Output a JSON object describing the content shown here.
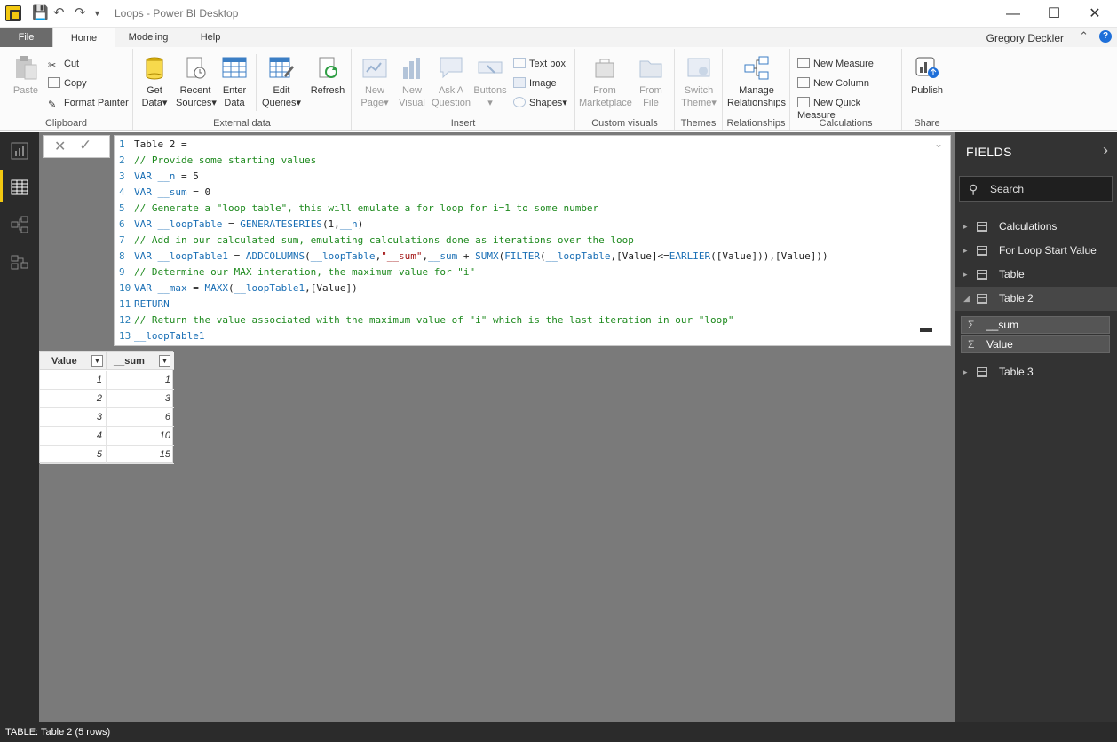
{
  "window": {
    "title": "Loops - Power BI Desktop",
    "user": "Gregory Deckler",
    "help_label": "?"
  },
  "tabs": [
    "File",
    "Home",
    "Modeling",
    "Help"
  ],
  "ribbon": {
    "clipboard": {
      "paste": "Paste",
      "cut": "Cut",
      "copy": "Copy",
      "format_painter": "Format Painter",
      "label": "Clipboard"
    },
    "external_data": {
      "get_data_1": "Get",
      "get_data_2": "Data",
      "recent_1": "Recent",
      "recent_2": "Sources",
      "enter_1": "Enter",
      "enter_2": "Data",
      "edit_1": "Edit",
      "edit_2": "Queries",
      "refresh": "Refresh",
      "label": "External data"
    },
    "insert": {
      "new_page_1": "New",
      "new_page_2": "Page",
      "new_visual_1": "New",
      "new_visual_2": "Visual",
      "ask_1": "Ask A",
      "ask_2": "Question",
      "buttons": "Buttons",
      "text_box": "Text box",
      "image": "Image",
      "shapes": "Shapes",
      "label": "Insert"
    },
    "custom_visuals": {
      "from_market_1": "From",
      "from_market_2": "Marketplace",
      "from_file_1": "From",
      "from_file_2": "File",
      "label": "Custom visuals"
    },
    "themes": {
      "switch_1": "Switch",
      "switch_2": "Theme",
      "label": "Themes"
    },
    "relationships": {
      "manage_1": "Manage",
      "manage_2": "Relationships",
      "label": "Relationships"
    },
    "calculations": {
      "new_measure": "New Measure",
      "new_column": "New Column",
      "new_quick_measure": "New Quick Measure",
      "label": "Calculations"
    },
    "share": {
      "publish": "Publish",
      "label": "Share"
    }
  },
  "editor": {
    "lines": [
      {
        "n": "1",
        "segs": [
          {
            "t": "Table 2 =",
            "c": ""
          }
        ]
      },
      {
        "n": "2",
        "segs": [
          {
            "t": "// Provide some starting values",
            "c": "cm"
          }
        ]
      },
      {
        "n": "3",
        "segs": [
          {
            "t": "VAR __n",
            "c": "kw"
          },
          {
            "t": " = 5",
            "c": ""
          }
        ]
      },
      {
        "n": "4",
        "segs": [
          {
            "t": "VAR __sum",
            "c": "kw"
          },
          {
            "t": " = 0",
            "c": ""
          }
        ]
      },
      {
        "n": "5",
        "segs": [
          {
            "t": "// Generate a \"loop table\", this will emulate a for loop for i=1 to some number",
            "c": "cm"
          }
        ]
      },
      {
        "n": "6",
        "segs": [
          {
            "t": "VAR __loopTable",
            "c": "kw"
          },
          {
            "t": " = ",
            "c": ""
          },
          {
            "t": "GENERATESERIES",
            "c": "kw"
          },
          {
            "t": "(1,",
            "c": ""
          },
          {
            "t": "__n",
            "c": "kw"
          },
          {
            "t": ")",
            "c": ""
          }
        ]
      },
      {
        "n": "7",
        "segs": [
          {
            "t": "// Add in our calculated sum, emulating calculations done as iterations over the loop",
            "c": "cm"
          }
        ]
      },
      {
        "n": "8",
        "segs": [
          {
            "t": "VAR __loopTable1",
            "c": "kw"
          },
          {
            "t": " = ",
            "c": ""
          },
          {
            "t": "ADDCOLUMNS",
            "c": "kw"
          },
          {
            "t": "(",
            "c": ""
          },
          {
            "t": "__loopTable",
            "c": "kw"
          },
          {
            "t": ",",
            "c": ""
          },
          {
            "t": "\"__sum\"",
            "c": "str"
          },
          {
            "t": ",",
            "c": ""
          },
          {
            "t": "__sum",
            "c": "kw"
          },
          {
            "t": " + ",
            "c": ""
          },
          {
            "t": "SUMX",
            "c": "kw"
          },
          {
            "t": "(",
            "c": ""
          },
          {
            "t": "FILTER",
            "c": "kw"
          },
          {
            "t": "(",
            "c": ""
          },
          {
            "t": "__loopTable",
            "c": "kw"
          },
          {
            "t": ",[Value]<=",
            "c": ""
          },
          {
            "t": "EARLIER",
            "c": "kw"
          },
          {
            "t": "([Value])),[Value]))",
            "c": ""
          }
        ]
      },
      {
        "n": "9",
        "segs": [
          {
            "t": "// Determine our MAX interation, the maximum value for \"i\"",
            "c": "cm"
          }
        ]
      },
      {
        "n": "10",
        "segs": [
          {
            "t": "VAR __max",
            "c": "kw"
          },
          {
            "t": " = ",
            "c": ""
          },
          {
            "t": "MAXX",
            "c": "kw"
          },
          {
            "t": "(",
            "c": ""
          },
          {
            "t": "__loopTable1",
            "c": "kw"
          },
          {
            "t": ",[Value])",
            "c": ""
          }
        ]
      },
      {
        "n": "11",
        "segs": [
          {
            "t": "RETURN",
            "c": "kw"
          }
        ]
      },
      {
        "n": "12",
        "segs": [
          {
            "t": "// Return the value associated with the maximum value of \"i\" which is the last iteration in our \"loop\"",
            "c": "cm"
          }
        ]
      },
      {
        "n": "13",
        "segs": [
          {
            "t": "__loopTable1",
            "c": "kw"
          }
        ]
      }
    ]
  },
  "table": {
    "columns": [
      "Value",
      "__sum"
    ],
    "rows": [
      [
        "1",
        "1"
      ],
      [
        "2",
        "3"
      ],
      [
        "3",
        "6"
      ],
      [
        "4",
        "10"
      ],
      [
        "5",
        "15"
      ]
    ]
  },
  "fields": {
    "title": "FIELDS",
    "search_placeholder": "Search",
    "items": [
      {
        "label": "Calculations",
        "icon": "calculator-icon",
        "expanded": false
      },
      {
        "label": "For Loop Start Value",
        "icon": "table-icon",
        "expanded": false
      },
      {
        "label": "Table",
        "icon": "table-icon",
        "expanded": false
      },
      {
        "label": "Table 2",
        "icon": "table-icon",
        "expanded": true
      },
      {
        "label": "Table 3",
        "icon": "table-icon",
        "expanded": false
      }
    ],
    "table2_fields": [
      "__sum",
      "Value"
    ]
  },
  "status": "TABLE: Table 2 (5 rows)",
  "colors": {
    "accent": "#f2c811",
    "file_tab": "#6b6b6b",
    "panel": "#333333",
    "canvas": "#7a7a7a"
  }
}
